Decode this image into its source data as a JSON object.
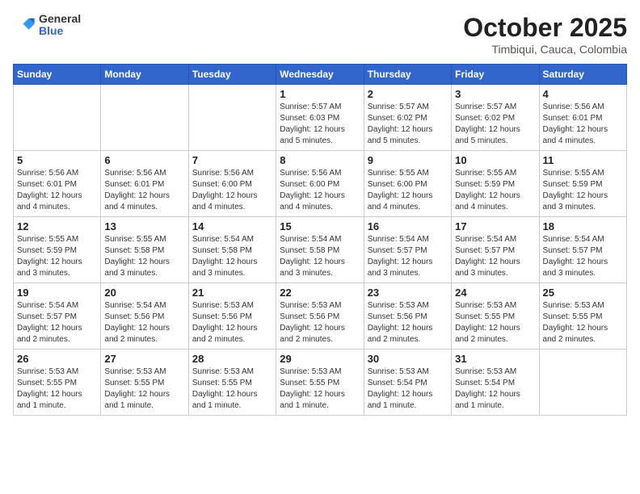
{
  "header": {
    "logo": {
      "general": "General",
      "blue": "Blue"
    },
    "title": "October 2025",
    "location": "Timbiqui, Cauca, Colombia"
  },
  "calendar": {
    "days_of_week": [
      "Sunday",
      "Monday",
      "Tuesday",
      "Wednesday",
      "Thursday",
      "Friday",
      "Saturday"
    ],
    "weeks": [
      [
        {
          "day": "",
          "info": ""
        },
        {
          "day": "",
          "info": ""
        },
        {
          "day": "",
          "info": ""
        },
        {
          "day": "1",
          "info": "Sunrise: 5:57 AM\nSunset: 6:03 PM\nDaylight: 12 hours\nand 5 minutes."
        },
        {
          "day": "2",
          "info": "Sunrise: 5:57 AM\nSunset: 6:02 PM\nDaylight: 12 hours\nand 5 minutes."
        },
        {
          "day": "3",
          "info": "Sunrise: 5:57 AM\nSunset: 6:02 PM\nDaylight: 12 hours\nand 5 minutes."
        },
        {
          "day": "4",
          "info": "Sunrise: 5:56 AM\nSunset: 6:01 PM\nDaylight: 12 hours\nand 4 minutes."
        }
      ],
      [
        {
          "day": "5",
          "info": "Sunrise: 5:56 AM\nSunset: 6:01 PM\nDaylight: 12 hours\nand 4 minutes."
        },
        {
          "day": "6",
          "info": "Sunrise: 5:56 AM\nSunset: 6:01 PM\nDaylight: 12 hours\nand 4 minutes."
        },
        {
          "day": "7",
          "info": "Sunrise: 5:56 AM\nSunset: 6:00 PM\nDaylight: 12 hours\nand 4 minutes."
        },
        {
          "day": "8",
          "info": "Sunrise: 5:56 AM\nSunset: 6:00 PM\nDaylight: 12 hours\nand 4 minutes."
        },
        {
          "day": "9",
          "info": "Sunrise: 5:55 AM\nSunset: 6:00 PM\nDaylight: 12 hours\nand 4 minutes."
        },
        {
          "day": "10",
          "info": "Sunrise: 5:55 AM\nSunset: 5:59 PM\nDaylight: 12 hours\nand 4 minutes."
        },
        {
          "day": "11",
          "info": "Sunrise: 5:55 AM\nSunset: 5:59 PM\nDaylight: 12 hours\nand 3 minutes."
        }
      ],
      [
        {
          "day": "12",
          "info": "Sunrise: 5:55 AM\nSunset: 5:59 PM\nDaylight: 12 hours\nand 3 minutes."
        },
        {
          "day": "13",
          "info": "Sunrise: 5:55 AM\nSunset: 5:58 PM\nDaylight: 12 hours\nand 3 minutes."
        },
        {
          "day": "14",
          "info": "Sunrise: 5:54 AM\nSunset: 5:58 PM\nDaylight: 12 hours\nand 3 minutes."
        },
        {
          "day": "15",
          "info": "Sunrise: 5:54 AM\nSunset: 5:58 PM\nDaylight: 12 hours\nand 3 minutes."
        },
        {
          "day": "16",
          "info": "Sunrise: 5:54 AM\nSunset: 5:57 PM\nDaylight: 12 hours\nand 3 minutes."
        },
        {
          "day": "17",
          "info": "Sunrise: 5:54 AM\nSunset: 5:57 PM\nDaylight: 12 hours\nand 3 minutes."
        },
        {
          "day": "18",
          "info": "Sunrise: 5:54 AM\nSunset: 5:57 PM\nDaylight: 12 hours\nand 3 minutes."
        }
      ],
      [
        {
          "day": "19",
          "info": "Sunrise: 5:54 AM\nSunset: 5:57 PM\nDaylight: 12 hours\nand 2 minutes."
        },
        {
          "day": "20",
          "info": "Sunrise: 5:54 AM\nSunset: 5:56 PM\nDaylight: 12 hours\nand 2 minutes."
        },
        {
          "day": "21",
          "info": "Sunrise: 5:53 AM\nSunset: 5:56 PM\nDaylight: 12 hours\nand 2 minutes."
        },
        {
          "day": "22",
          "info": "Sunrise: 5:53 AM\nSunset: 5:56 PM\nDaylight: 12 hours\nand 2 minutes."
        },
        {
          "day": "23",
          "info": "Sunrise: 5:53 AM\nSunset: 5:56 PM\nDaylight: 12 hours\nand 2 minutes."
        },
        {
          "day": "24",
          "info": "Sunrise: 5:53 AM\nSunset: 5:55 PM\nDaylight: 12 hours\nand 2 minutes."
        },
        {
          "day": "25",
          "info": "Sunrise: 5:53 AM\nSunset: 5:55 PM\nDaylight: 12 hours\nand 2 minutes."
        }
      ],
      [
        {
          "day": "26",
          "info": "Sunrise: 5:53 AM\nSunset: 5:55 PM\nDaylight: 12 hours\nand 1 minute."
        },
        {
          "day": "27",
          "info": "Sunrise: 5:53 AM\nSunset: 5:55 PM\nDaylight: 12 hours\nand 1 minute."
        },
        {
          "day": "28",
          "info": "Sunrise: 5:53 AM\nSunset: 5:55 PM\nDaylight: 12 hours\nand 1 minute."
        },
        {
          "day": "29",
          "info": "Sunrise: 5:53 AM\nSunset: 5:55 PM\nDaylight: 12 hours\nand 1 minute."
        },
        {
          "day": "30",
          "info": "Sunrise: 5:53 AM\nSunset: 5:54 PM\nDaylight: 12 hours\nand 1 minute."
        },
        {
          "day": "31",
          "info": "Sunrise: 5:53 AM\nSunset: 5:54 PM\nDaylight: 12 hours\nand 1 minute."
        },
        {
          "day": "",
          "info": ""
        }
      ]
    ]
  }
}
